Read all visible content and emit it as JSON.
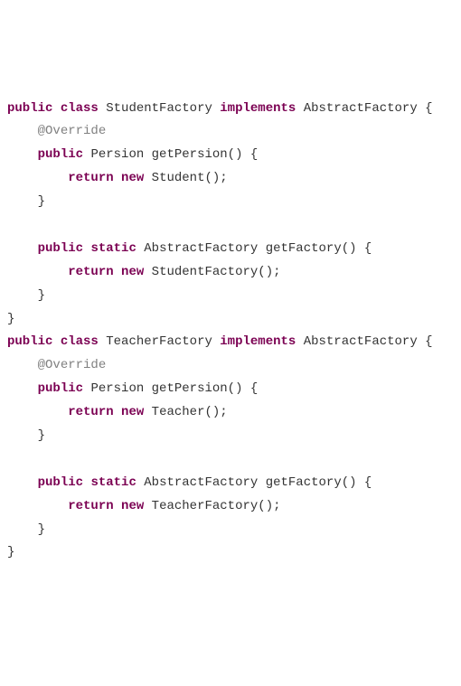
{
  "code": {
    "l1_public": "public",
    "l1_class": "class",
    "l1_name": "StudentFactory",
    "l1_implements": "implements",
    "l1_iface": "AbstractFactory",
    "l1_brace": " {",
    "l2_override": "@Override",
    "l3_public": "public",
    "l3_ret": "Persion",
    "l3_method": "getPersion() {",
    "l4_return": "return",
    "l4_new": "new",
    "l4_ctor": "Student();",
    "l5_close": "}",
    "l7_public": "public",
    "l7_static": "static",
    "l7_ret": "AbstractFactory",
    "l7_method": "getFactory() {",
    "l8_return": "return",
    "l8_new": "new",
    "l8_ctor": "StudentFactory();",
    "l9_close": "}",
    "l10_close": "}",
    "l11_public": "public",
    "l11_class": "class",
    "l11_name": "TeacherFactory",
    "l11_implements": "implements",
    "l11_iface": "AbstractFactory",
    "l11_brace": " {",
    "l12_override": "@Override",
    "l13_public": "public",
    "l13_ret": "Persion",
    "l13_method": "getPersion() {",
    "l14_return": "return",
    "l14_new": "new",
    "l14_ctor": "Teacher();",
    "l15_close": "}",
    "l17_public": "public",
    "l17_static": "static",
    "l17_ret": "AbstractFactory",
    "l17_method": "getFactory() {",
    "l18_return": "return",
    "l18_new": "new",
    "l18_ctor": "TeacherFactory();",
    "l19_close": "}",
    "l20_close": "}"
  }
}
